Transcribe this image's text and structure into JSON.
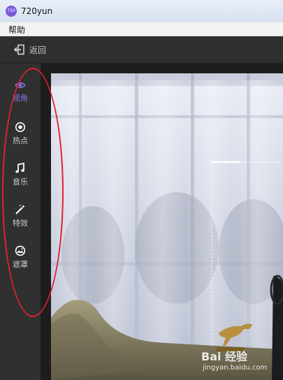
{
  "window": {
    "title": "720yun",
    "logo_text": "720"
  },
  "menu": {
    "help": "帮助"
  },
  "toolbar": {
    "back_label": "返回"
  },
  "sidebar": {
    "accent_color": "#8a72e6",
    "items": [
      {
        "label": "视角",
        "icon": "eye-icon",
        "active": true
      },
      {
        "label": "热点",
        "icon": "target-icon",
        "active": false
      },
      {
        "label": "音乐",
        "icon": "music-note-icon",
        "active": false
      },
      {
        "label": "特效",
        "icon": "magic-wand-icon",
        "active": false
      },
      {
        "label": "遮罩",
        "icon": "image-icon",
        "active": false
      }
    ]
  },
  "annotation": {
    "color": "#e02030"
  },
  "watermark": {
    "line1": "Bai 经验",
    "line2": "jingyan.baidu.com"
  }
}
